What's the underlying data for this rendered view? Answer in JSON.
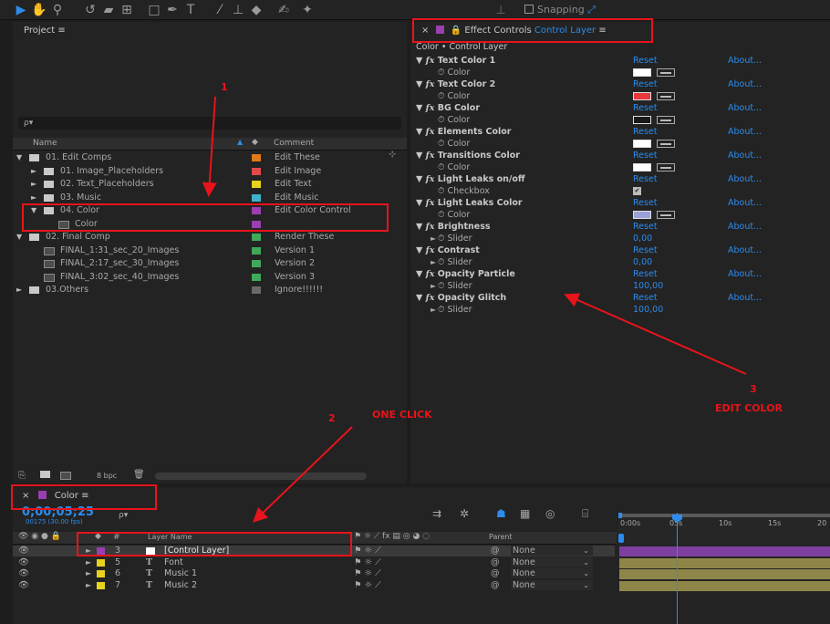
{
  "toolbar": {
    "snapping_label": "Snapping"
  },
  "project": {
    "title": "Project",
    "menu_icon": "≡",
    "search_icon": "ρ▾",
    "columns": {
      "name": "Name",
      "comment": "Comment"
    },
    "rows": [
      {
        "name": "01. Edit Comps",
        "type": "folder",
        "expanded": true,
        "indent": 0,
        "color": "#e07a1a",
        "comment": "Edit These"
      },
      {
        "name": "01. Image_Placeholders",
        "type": "folder",
        "expanded": false,
        "indent": 1,
        "color": "#e04a4a",
        "comment": "Edit Image"
      },
      {
        "name": "02. Text_Placeholders",
        "type": "folder",
        "expanded": false,
        "indent": 1,
        "color": "#e8d220",
        "comment": "Edit Text"
      },
      {
        "name": "03. Music",
        "type": "folder",
        "expanded": false,
        "indent": 1,
        "color": "#3fb2c8",
        "comment": "Edit Music"
      },
      {
        "name": "04. Color",
        "type": "folder",
        "expanded": true,
        "indent": 1,
        "color": "#9b3fb0",
        "comment": "Edit Color Control"
      },
      {
        "name": "Color",
        "type": "comp",
        "expanded": null,
        "indent": 2,
        "color": "#9b3fb0",
        "comment": ""
      },
      {
        "name": "02. Final Comp",
        "type": "folder",
        "expanded": true,
        "indent": 0,
        "color": "#3fa85a",
        "comment": "Render These"
      },
      {
        "name": "FINAL_1:31_sec_20_Images",
        "type": "comp",
        "expanded": null,
        "indent": 1,
        "color": "#3fa85a",
        "comment": "Version 1"
      },
      {
        "name": "FINAL_2:17_sec_30_Images",
        "type": "comp",
        "expanded": null,
        "indent": 1,
        "color": "#3fa85a",
        "comment": "Version 2"
      },
      {
        "name": "FINAL_3:02_sec_40_Images",
        "type": "comp",
        "expanded": null,
        "indent": 1,
        "color": "#3fa85a",
        "comment": "Version 3"
      },
      {
        "name": "03.Others",
        "type": "folder",
        "expanded": false,
        "indent": 0,
        "color": "#6a6a6a",
        "comment": "Ignore!!!!!!"
      }
    ],
    "footer": {
      "bpc": "8 bpc"
    }
  },
  "effect_controls": {
    "title_prefix": "Effect Controls",
    "title_layer": "Control Layer",
    "menu_icon": "≡",
    "breadcrumb": "Color • Control Layer",
    "reset": "Reset",
    "about": "About...",
    "effects": [
      {
        "name": "Text Color 1",
        "prop": "Color",
        "kind": "color",
        "value": "#ffffff",
        "expanded": true
      },
      {
        "name": "Text Color 2",
        "prop": "Color",
        "kind": "color",
        "value": "#e8383f",
        "expanded": true
      },
      {
        "name": "BG Color",
        "prop": "Color",
        "kind": "color",
        "value": "#1a1a1a",
        "expanded": true
      },
      {
        "name": "Elements Color",
        "prop": "Color",
        "kind": "color",
        "value": "#ffffff",
        "expanded": true
      },
      {
        "name": "Transitions Color",
        "prop": "Color",
        "kind": "color",
        "value": "#ffffff",
        "expanded": true
      },
      {
        "name": "Light Leaks on/off",
        "prop": "Checkbox",
        "kind": "checkbox",
        "value": "✔",
        "expanded": true
      },
      {
        "name": "Light Leaks Color",
        "prop": "Color",
        "kind": "color",
        "value": "#9aa0d8",
        "expanded": true
      },
      {
        "name": "Brightness",
        "prop": "Slider",
        "kind": "slider",
        "value": "0,00",
        "expanded": true
      },
      {
        "name": "Contrast",
        "prop": "Slider",
        "kind": "slider",
        "value": "0,00",
        "expanded": true
      },
      {
        "name": "Opacity Particle",
        "prop": "Slider",
        "kind": "slider",
        "value": "100,00",
        "expanded": true
      },
      {
        "name": "Opacity Glitch",
        "prop": "Slider",
        "kind": "slider",
        "value": "100,00",
        "expanded": true
      }
    ]
  },
  "timeline": {
    "tab_label": "Color",
    "menu_icon": "≡",
    "timecode": "0;00;05;25",
    "fps": "00175 (30.00 fps)",
    "search_icon": "ρ▾",
    "cols": {
      "num": "#",
      "layer_name": "Layer Name",
      "parent": "Parent"
    },
    "ruler": [
      "0:00s",
      "05s",
      "10s",
      "15s",
      "20"
    ],
    "layers": [
      {
        "num": "3",
        "name": "[Control Layer]",
        "type": "solid",
        "color": "#9b3fb0",
        "parent": "None",
        "selected": true
      },
      {
        "num": "5",
        "name": "Font",
        "type": "text",
        "color": "#e8d220",
        "parent": "None",
        "selected": false
      },
      {
        "num": "6",
        "name": "Music 1",
        "type": "text",
        "color": "#e8d220",
        "parent": "None",
        "selected": false
      },
      {
        "num": "7",
        "name": "Music 2",
        "type": "text",
        "color": "#e8d220",
        "parent": "None",
        "selected": false
      }
    ]
  },
  "annotations": {
    "n1": "1",
    "n2": "2",
    "one_click": "ONE CLICK",
    "n3": "3",
    "edit_color": "EDIT COLOR"
  }
}
